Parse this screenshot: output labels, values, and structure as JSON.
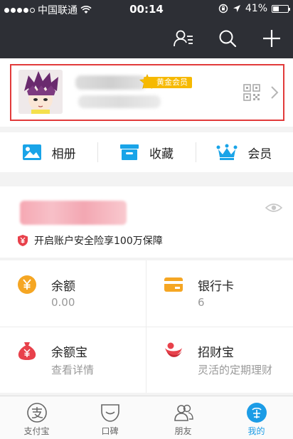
{
  "status_bar": {
    "carrier": "中国联通",
    "time": "00:14",
    "battery": "41%",
    "battery_level": 0.41
  },
  "toolbar": {
    "icons": [
      "contacts-icon",
      "search-icon",
      "add-icon"
    ]
  },
  "profile": {
    "badge": "黄金会员",
    "icons": [
      "avatar",
      "qr-code-icon",
      "chevron-right-icon"
    ]
  },
  "quick_actions": [
    {
      "label": "相册",
      "icon": "album-icon"
    },
    {
      "label": "收藏",
      "icon": "favorites-icon"
    },
    {
      "label": "会员",
      "icon": "crown-icon"
    }
  ],
  "balance": {
    "secure_text": "开启账户安全险享100万保障"
  },
  "assets": [
    {
      "title": "余额",
      "sub": "0.00",
      "icon": "yuan-coin-icon"
    },
    {
      "title": "银行卡",
      "sub": "6",
      "icon": "bank-card-icon"
    },
    {
      "title": "余额宝",
      "sub": "查看详情",
      "icon": "money-bag-icon"
    },
    {
      "title": "招财宝",
      "sub": "灵活的定期理财",
      "icon": "zhaocaibao-icon"
    }
  ],
  "tabs": [
    {
      "label": "支付宝",
      "icon": "alipay-icon"
    },
    {
      "label": "口碑",
      "icon": "koubei-icon"
    },
    {
      "label": "朋友",
      "icon": "friends-icon"
    },
    {
      "label": "我的",
      "icon": "mine-icon"
    }
  ],
  "colors": {
    "header": "#2d2f35",
    "accent_blue": "#1c9ce6",
    "badge_gold": "#f6b900",
    "highlight_red": "#e23b3b",
    "coin_orange": "#f5a623",
    "red": "#e8414b"
  }
}
